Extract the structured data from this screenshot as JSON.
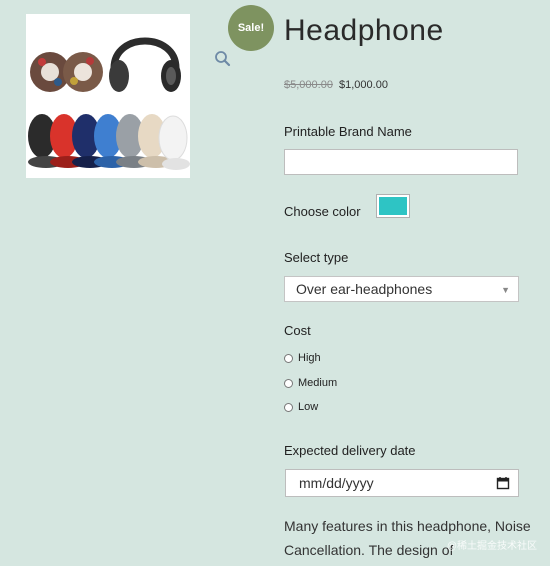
{
  "product": {
    "sale_badge": "Sale!",
    "title": "Headphone",
    "old_price": "$5,000.00",
    "price": "$1,000.00",
    "image_alt": "Headphones and ear cushions in multiple colors"
  },
  "form": {
    "brand_name_label": "Printable Brand Name",
    "brand_name_value": "",
    "color_label": "Choose color",
    "color_value": "#2ec4c4",
    "select_type_label": "Select type",
    "select_type_value": "Over ear-headphones",
    "cost_label": "Cost",
    "cost_options": [
      "High",
      "Medium",
      "Low"
    ],
    "delivery_label": "Expected delivery date",
    "delivery_placeholder": "mm/dd/yyyy"
  },
  "description": "Many features in this headphone, Noise Cancellation. The design of",
  "watermark": "@稀土掘金技术社区"
}
